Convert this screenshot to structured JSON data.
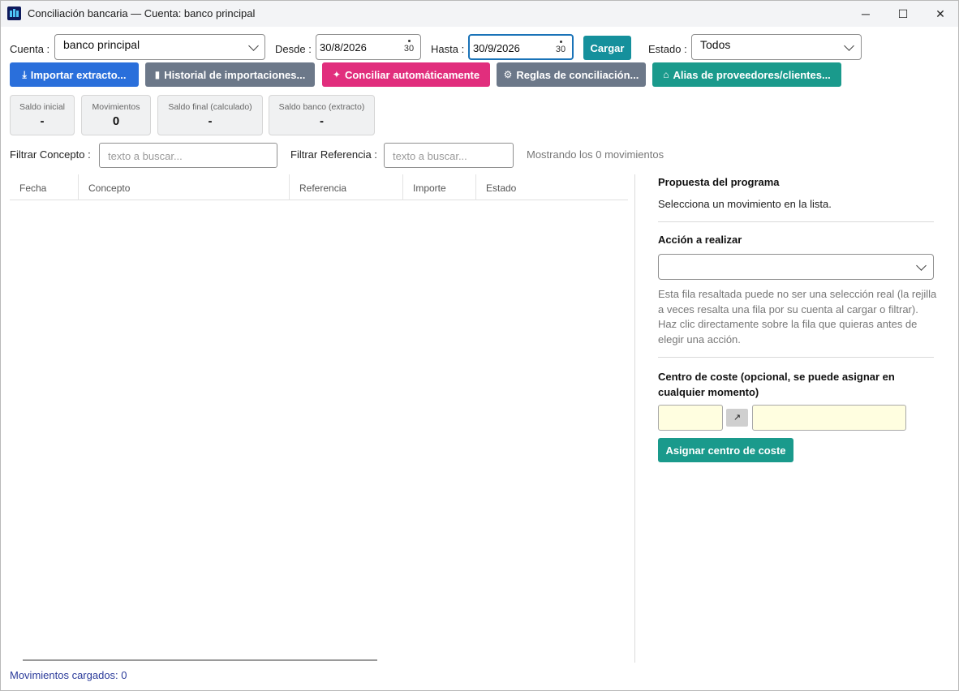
{
  "window": {
    "title": "Conciliación bancaria — Cuenta: banco principal",
    "minimize": "─",
    "maximize": "☐",
    "close": "✕"
  },
  "filters_top": {
    "cuenta_label": "Cuenta :",
    "cuenta_value": "banco principal",
    "desde_label": "Desde :",
    "desde_value": "30/8/2026",
    "hasta_label": "Hasta :",
    "hasta_value": "30/9/2026",
    "calendar_day": "30",
    "cargar_label": "Cargar",
    "estado_label": "Estado :",
    "estado_value": "Todos"
  },
  "toolbar": {
    "importar": "Importar extracto...",
    "historial": "Historial de importaciones...",
    "conciliar": "Conciliar automáticamente",
    "reglas": "Reglas de conciliación...",
    "alias": "Alias de proveedores/clientes...",
    "colors": {
      "importar": "#2a6fdb",
      "historial": "#6c7889",
      "conciliar": "#e12e7d",
      "reglas": "#6c7889",
      "alias": "#1a9a8c",
      "cargar": "#15909c"
    }
  },
  "summary": {
    "saldo_inicial": {
      "label": "Saldo inicial",
      "value": "-"
    },
    "movimientos": {
      "label": "Movimientos",
      "value": "0"
    },
    "saldo_final": {
      "label": "Saldo final (calculado)",
      "value": "-"
    },
    "saldo_banco": {
      "label": "Saldo banco (extracto)",
      "value": "-"
    }
  },
  "search": {
    "concepto_label": "Filtrar Concepto :",
    "concepto_placeholder": "texto a buscar...",
    "referencia_label": "Filtrar Referencia :",
    "referencia_placeholder": "texto a buscar...",
    "showing": "Mostrando los 0 movimientos"
  },
  "table": {
    "columns": [
      "Fecha",
      "Concepto",
      "Referencia",
      "Importe",
      "Estado"
    ],
    "rows": []
  },
  "footer": {
    "loaded": "Movimientos cargados: 0"
  },
  "panel": {
    "propuesta_title": "Propuesta del programa",
    "propuesta_text": "Selecciona un movimiento en la lista.",
    "accion_title": "Acción a realizar",
    "accion_value": "",
    "note": "Esta fila resaltada puede no ser una selección real (la rejilla a veces resalta una fila por su cuenta al cargar o filtrar). Haz clic directamente sobre la fila que quieras antes de elegir una acción.",
    "centro_title": "Centro de coste (opcional, se puede asignar en cualquier momento)",
    "link_glyph": "↗",
    "asignar_label": "Asignar centro de coste"
  }
}
